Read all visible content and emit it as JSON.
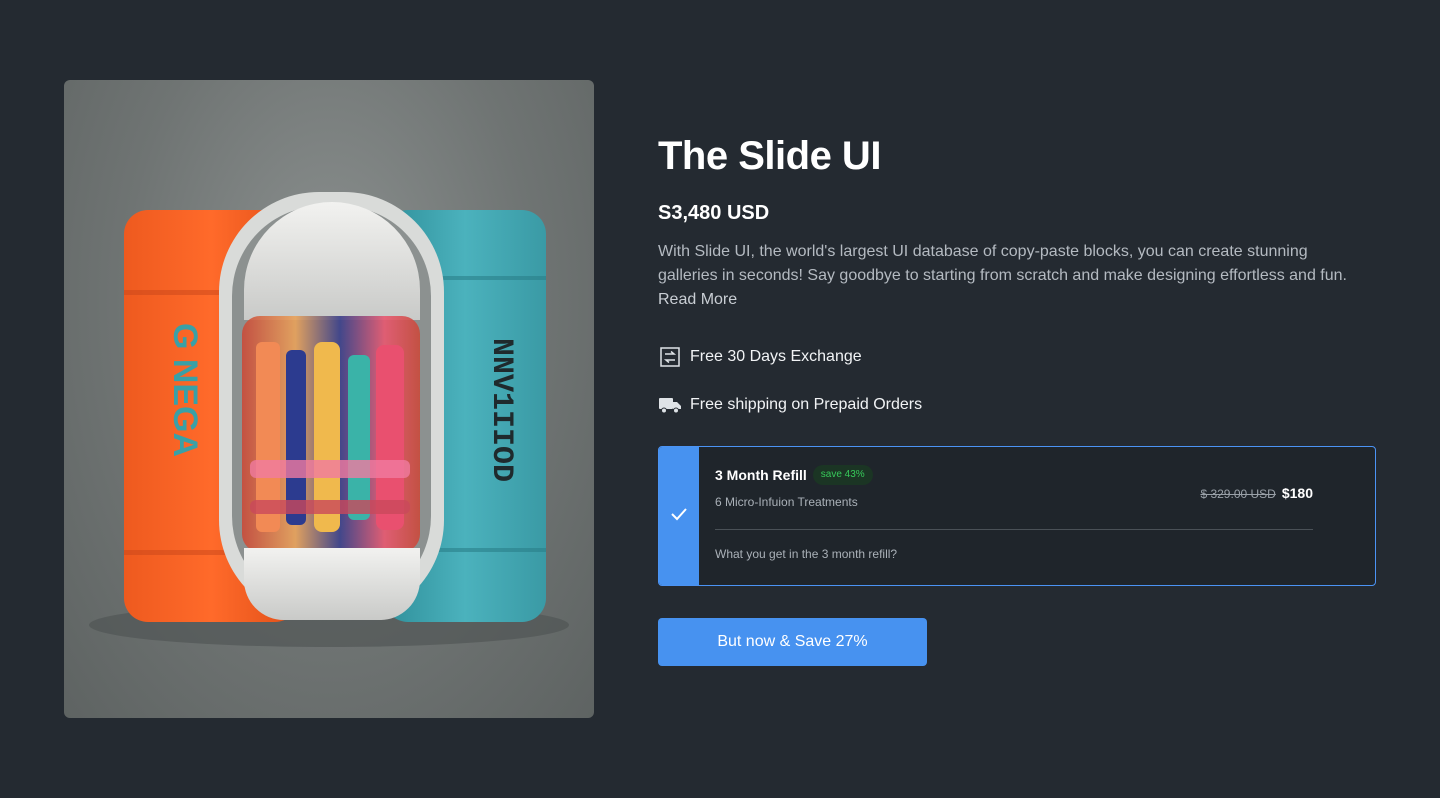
{
  "product": {
    "title": "The Slide UI",
    "price": "S3,480 USD",
    "description": "With Slide UI, the world's largest UI database of copy-paste blocks, you can create stunning galleries in seconds! Say goodbye to starting from scratch and make designing effortless and fun. ",
    "read_more": "Read More"
  },
  "perks": [
    {
      "icon": "exchange-icon",
      "label": "Free 30 Days Exchange"
    },
    {
      "icon": "truck-icon",
      "label": "Free shipping on Prepaid Orders"
    }
  ],
  "plan": {
    "selected": true,
    "name": "3 Month Refill",
    "badge": "save 43%",
    "subtitle": "6 Micro-Infuion Treatments",
    "old_price": "$ 329.00 USD",
    "new_price": "$180",
    "note": "What you get in the 3 month refill?"
  },
  "cta": {
    "label": "But now & Save 27%"
  },
  "colors": {
    "background": "#242a31",
    "accent": "#4792f0",
    "badge_text": "#37c95a",
    "orange": "#f2581f",
    "teal": "#3fa7b3"
  }
}
